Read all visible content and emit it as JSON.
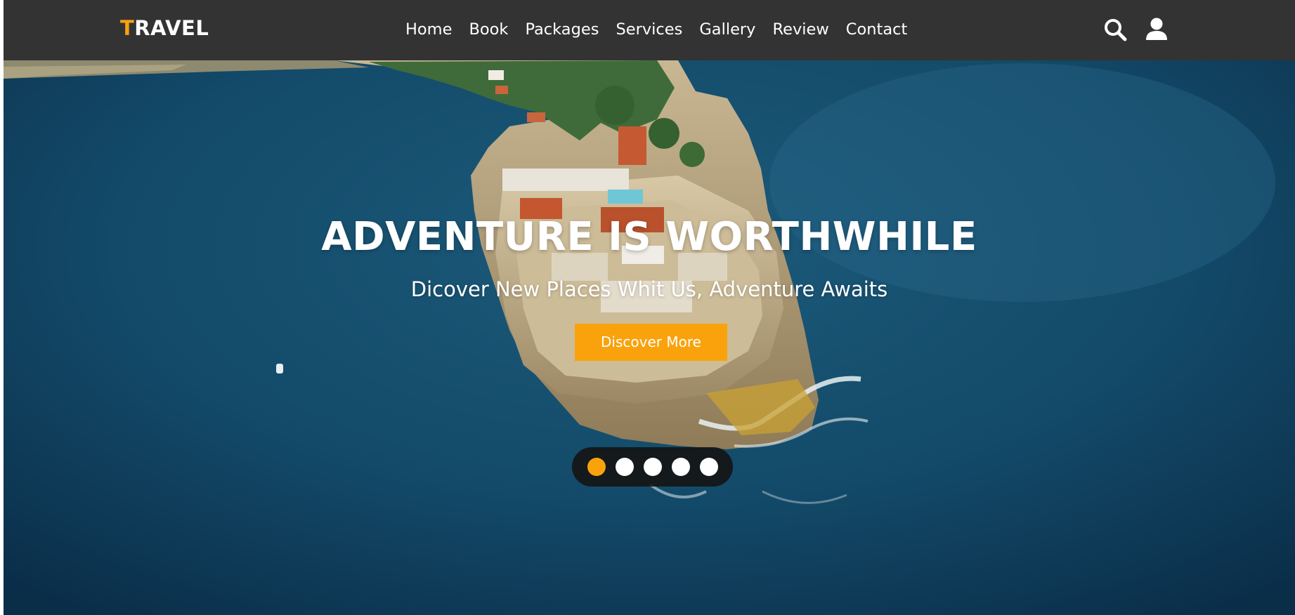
{
  "header": {
    "logo_accent": "T",
    "logo_rest": "RAVEL",
    "nav": [
      "Home",
      "Book",
      "Packages",
      "Services",
      "Gallery",
      "Review",
      "Contact"
    ],
    "icons": [
      "search-icon",
      "user-icon"
    ]
  },
  "hero": {
    "title": "ADVENTURE IS WORTHWHILE",
    "subtitle": "Dicover New Places Whit Us, Adventure Awaits",
    "cta_label": "Discover More",
    "slides": {
      "count": 5,
      "active": 1
    }
  },
  "colors": {
    "header_bg": "#333333",
    "accent": "#f9a20c",
    "text": "#ffffff",
    "sea": "#0f3b58"
  }
}
